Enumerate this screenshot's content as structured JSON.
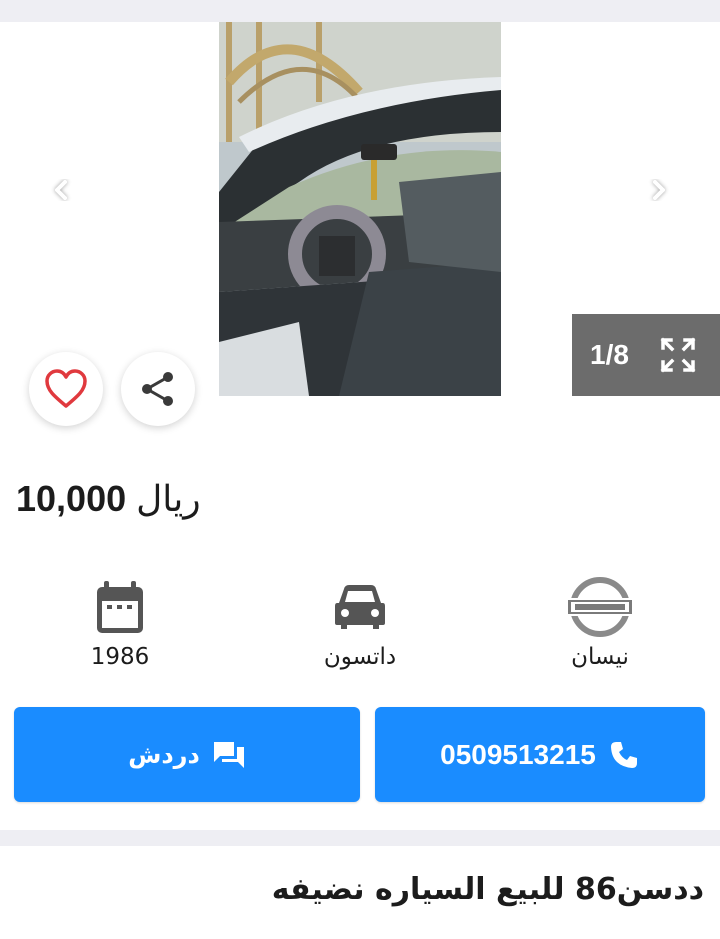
{
  "gallery": {
    "counter": "1/8",
    "prev_icon": "chevron-left-icon",
    "next_icon": "chevron-right-icon",
    "fullscreen_icon": "expand-icon"
  },
  "actions": {
    "favorite_icon": "heart-icon",
    "share_icon": "share-icon"
  },
  "price": {
    "amount": "10,000",
    "currency": "ريال"
  },
  "specs": {
    "year": "1986",
    "model": "داتسون",
    "make": "نيسان"
  },
  "buttons": {
    "chat_label": "دردش",
    "call_label": "0509513215"
  },
  "listing": {
    "title": "ددسن86 للبيع السياره نضيفه"
  },
  "colors": {
    "primary": "#1a8cff",
    "favorite": "#e0393e",
    "counter_bg": "#6c6c6c"
  }
}
